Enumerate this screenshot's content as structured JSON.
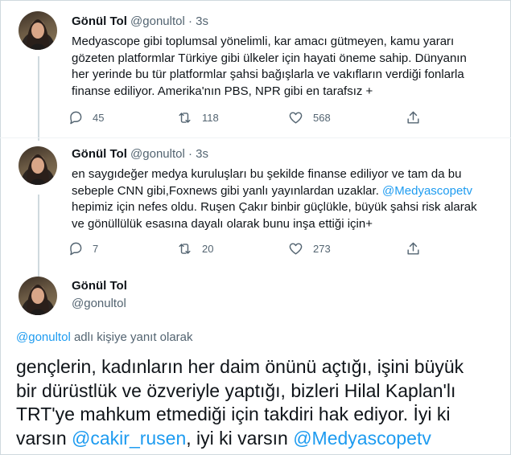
{
  "tweets": [
    {
      "name": "Gönül Tol",
      "handle": "@gonultol",
      "dot": "·",
      "time": "3s",
      "lines": [
        "Medyascope gibi toplumsal yönelimli, kar amacı gütmeyen, kamu yararı",
        "gözeten platformlar Türkiye gibi ülkeler için hayati öneme sahip. Dünyanın",
        "her yerinde bu tür platformlar şahsi bağışlarla ve vakıfların verdiği fonlarla",
        "finanse ediliyor. Amerika'nın PBS, NPR gibi en tarafsız +"
      ],
      "replies": "45",
      "retweets": "118",
      "likes": "568"
    },
    {
      "name": "Gönül Tol",
      "handle": "@gonultol",
      "dot": "·",
      "time": "3s",
      "line1": "en saygıdeğer medya kuruluşları bu şekilde finanse ediliyor ve tam da bu",
      "line2_pre": "sebeple CNN gibi,Foxnews gibi yanlı yayınlardan uzaklar. ",
      "line2_mention": "@Medyascopetv",
      "line3": "hepimiz için nefes oldu. Ruşen Çakır binbir güçlükle, büyük şahsi risk alarak",
      "line4": "ve gönüllülük esasına dayalı olarak bunu inşa ettiği için+",
      "replies": "7",
      "retweets": "20",
      "likes": "273"
    }
  ],
  "main": {
    "name": "Gönül Tol",
    "handle": "@gonultol",
    "reply_mention": "@gonultol",
    "reply_suffix": " adlı kişiye yanıt olarak",
    "line1": "gençlerin, kadınların her daim önünü açtığı, işini büyük",
    "line2": "bir dürüstlük ve özveriyle yaptığı, bizleri Hilal Kaplan'lı",
    "line3": "TRT'ye mahkum etmediği için takdiri hak ediyor. İyi ki",
    "line4_pre": "varsın ",
    "line4_mention1": "@cakir_rusen",
    "line4_mid": ", iyi ki varsın ",
    "line4_mention2": "@Medyascopetv"
  },
  "colors": {
    "accent": "#1d9bf0",
    "text": "#0f1419",
    "muted": "#536471"
  }
}
